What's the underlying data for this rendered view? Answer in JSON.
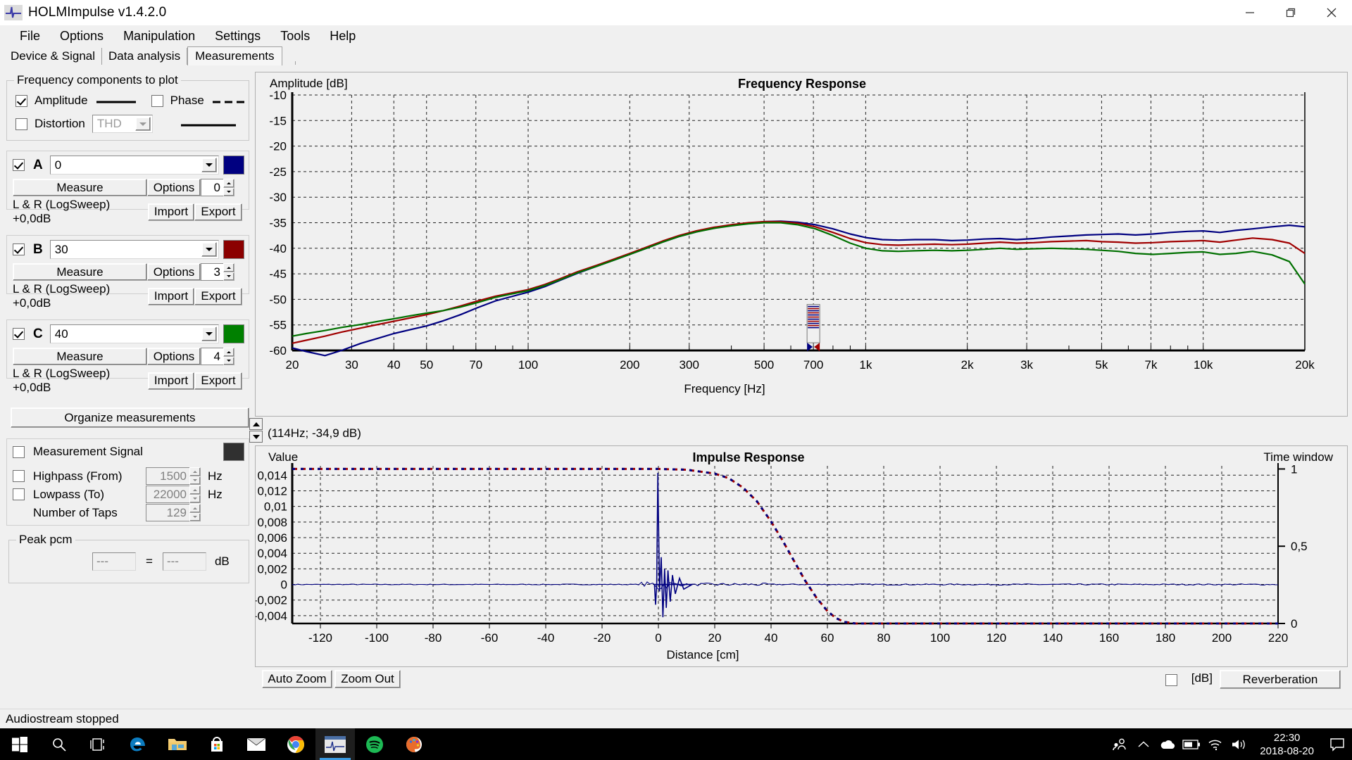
{
  "window": {
    "title": "HOLMImpulse  v1.4.2.0",
    "icon": "holmimpulse-logo-icon",
    "minimize": "minimize-icon",
    "maximize": "restore-icon",
    "close": "close-icon"
  },
  "menu": [
    "File",
    "Options",
    "Manipulation",
    "Settings",
    "Tools",
    "Help"
  ],
  "tabs": [
    {
      "label": "Device & Signal",
      "active": false
    },
    {
      "label": "Data analysis",
      "active": false
    },
    {
      "label": "Measurements",
      "active": true
    }
  ],
  "freq_components": {
    "title": "Frequency components to plot",
    "amplitude": {
      "label": "Amplitude",
      "checked": true,
      "line": "solid"
    },
    "phase": {
      "label": "Phase",
      "checked": false,
      "line": "dashed"
    },
    "distortion": {
      "label": "Distortion",
      "checked": false,
      "select_value": "THD",
      "line": "solid"
    }
  },
  "measurements": [
    {
      "id": "A",
      "checked": true,
      "name": "0",
      "measure": "Measure",
      "options": "Options",
      "index": "0",
      "info": "L & R (LogSweep) +0,0dB",
      "import": "Import",
      "export": "Export",
      "color": "#000080"
    },
    {
      "id": "B",
      "checked": true,
      "name": "30",
      "measure": "Measure",
      "options": "Options",
      "index": "3",
      "info": "L & R (LogSweep) +0,0dB",
      "import": "Import",
      "export": "Export",
      "color": "#8b0000"
    },
    {
      "id": "C",
      "checked": true,
      "name": "40",
      "measure": "Measure",
      "options": "Options",
      "index": "4",
      "info": "L & R (LogSweep) +0,0dB",
      "import": "Import",
      "export": "Export",
      "color": "#008000"
    }
  ],
  "organize_button": "Organize measurements",
  "measurement_signal": {
    "label": "Measurement Signal",
    "checked": false,
    "color": "#303030"
  },
  "filters": {
    "highpass": {
      "label": "Highpass (From)",
      "checked": false,
      "value": "1500",
      "unit": "Hz"
    },
    "lowpass": {
      "label": "Lowpass (To)",
      "checked": false,
      "value": "22000",
      "unit": "Hz"
    },
    "taps": {
      "label": "Number of Taps",
      "value": "129"
    }
  },
  "peak_pcm": {
    "title": "Peak pcm",
    "value1": "---",
    "equals": "=",
    "value2": "---",
    "unit": "dB"
  },
  "cursor_readout": "(114Hz; -34,9 dB)",
  "impulse_buttons": {
    "auto_zoom": "Auto Zoom",
    "zoom_out": "Zoom Out"
  },
  "impulse_footer": {
    "db_label": "[dB]",
    "db_checked": false,
    "reverberation": "Reverberation"
  },
  "statusbar": "Audiostream stopped",
  "taskbar": {
    "items": [
      "start-icon",
      "search-icon",
      "task-view-icon",
      "edge-icon",
      "file-explorer-icon",
      "microsoft-store-icon",
      "mail-icon",
      "chrome-icon",
      "holmimpulse-icon",
      "spotify-icon",
      "paint-3d-icon"
    ],
    "tray": [
      "people-icon",
      "show-hidden-icons-icon",
      "onedrive-icon",
      "battery-icon",
      "wifi-icon",
      "volume-icon"
    ],
    "time": "22:30",
    "date": "2018-08-20",
    "action_center": "action-center-icon"
  },
  "chart_data": [
    {
      "type": "line",
      "name": "frequency-response",
      "title": "Frequency Response",
      "xlabel": "Frequency [Hz]",
      "ylabel": "Amplitude [dB]",
      "xscale": "log",
      "xlim": [
        20,
        20000
      ],
      "ylim": [
        -60,
        -10
      ],
      "yticks": [
        -10,
        -15,
        -20,
        -25,
        -30,
        -35,
        -40,
        -45,
        -50,
        -55,
        -60
      ],
      "xticks": [
        20,
        30,
        40,
        50,
        70,
        100,
        200,
        300,
        500,
        700,
        1000,
        2000,
        3000,
        5000,
        7000,
        10000,
        20000
      ],
      "xticklabels": [
        "20",
        "30",
        "40",
        "50",
        "70",
        "100",
        "200",
        "300",
        "500",
        "700",
        "1k",
        "2k",
        "3k",
        "5k",
        "7k",
        "10k",
        "20k"
      ],
      "grid": true,
      "series": [
        {
          "name": "A",
          "color": "#000080",
          "x": [
            20,
            22,
            25,
            28,
            32,
            36,
            40,
            45,
            50,
            56,
            63,
            71,
            80,
            90,
            100,
            112,
            125,
            140,
            160,
            180,
            200,
            224,
            250,
            280,
            315,
            355,
            400,
            450,
            500,
            560,
            630,
            710,
            800,
            900,
            1000,
            1120,
            1250,
            1400,
            1600,
            1800,
            2000,
            2240,
            2500,
            2800,
            3150,
            3550,
            4000,
            4500,
            5000,
            5600,
            6300,
            7100,
            8000,
            9000,
            10000,
            11200,
            12500,
            14000,
            16000,
            18000,
            20000
          ],
          "y": [
            -59.5,
            -60.2,
            -61.0,
            -60.0,
            -58.6,
            -57.6,
            -56.7,
            -55.9,
            -55.2,
            -54.2,
            -53.0,
            -51.6,
            -50.3,
            -49.4,
            -48.6,
            -47.5,
            -46.2,
            -44.9,
            -43.5,
            -42.3,
            -41.2,
            -40.0,
            -38.8,
            -37.7,
            -36.8,
            -36.0,
            -35.5,
            -35.1,
            -34.8,
            -34.7,
            -34.9,
            -35.4,
            -36.2,
            -37.2,
            -37.9,
            -38.3,
            -38.4,
            -38.3,
            -38.3,
            -38.5,
            -38.4,
            -38.2,
            -38.1,
            -38.3,
            -38.1,
            -37.8,
            -37.6,
            -37.4,
            -37.3,
            -37.2,
            -37.4,
            -37.2,
            -36.9,
            -36.7,
            -36.6,
            -36.9,
            -36.5,
            -36.2,
            -35.8,
            -35.5,
            -35.8
          ]
        },
        {
          "name": "B",
          "color": "#a00000",
          "x": [
            20,
            22,
            25,
            28,
            32,
            36,
            40,
            45,
            50,
            56,
            63,
            71,
            80,
            90,
            100,
            112,
            125,
            140,
            160,
            180,
            200,
            224,
            250,
            280,
            315,
            355,
            400,
            450,
            500,
            560,
            630,
            710,
            800,
            900,
            1000,
            1120,
            1250,
            1400,
            1600,
            1800,
            2000,
            2240,
            2500,
            2800,
            3150,
            3550,
            4000,
            4500,
            5000,
            5600,
            6300,
            7100,
            8000,
            9000,
            10000,
            11200,
            12500,
            14000,
            16000,
            18000,
            20000
          ],
          "y": [
            -58.6,
            -58.0,
            -57.2,
            -56.4,
            -55.6,
            -54.9,
            -54.3,
            -53.6,
            -53.0,
            -52.2,
            -51.3,
            -50.3,
            -49.4,
            -48.7,
            -48.1,
            -47.1,
            -45.9,
            -44.6,
            -43.3,
            -42.1,
            -41.0,
            -39.8,
            -38.6,
            -37.5,
            -36.6,
            -35.9,
            -35.4,
            -35.0,
            -34.8,
            -34.8,
            -35.1,
            -35.8,
            -36.9,
            -38.1,
            -38.9,
            -39.3,
            -39.4,
            -39.3,
            -39.2,
            -39.3,
            -39.2,
            -39.0,
            -38.8,
            -39.0,
            -38.9,
            -38.7,
            -38.6,
            -38.5,
            -38.7,
            -38.8,
            -39.0,
            -38.9,
            -38.7,
            -38.6,
            -38.5,
            -38.8,
            -38.4,
            -38.0,
            -38.3,
            -39.0,
            -41.0
          ]
        },
        {
          "name": "C",
          "color": "#007000",
          "x": [
            20,
            22,
            25,
            28,
            32,
            36,
            40,
            45,
            50,
            56,
            63,
            71,
            80,
            90,
            100,
            112,
            125,
            140,
            160,
            180,
            200,
            224,
            250,
            280,
            315,
            355,
            400,
            450,
            500,
            560,
            630,
            710,
            800,
            900,
            1000,
            1120,
            1250,
            1400,
            1600,
            1800,
            2000,
            2240,
            2500,
            2800,
            3150,
            3550,
            4000,
            4500,
            5000,
            5600,
            6300,
            7100,
            8000,
            9000,
            10000,
            11200,
            12500,
            14000,
            16000,
            18000,
            20000
          ],
          "y": [
            -57.2,
            -56.7,
            -56.1,
            -55.5,
            -54.9,
            -54.3,
            -53.8,
            -53.2,
            -52.7,
            -52.2,
            -51.5,
            -50.6,
            -49.6,
            -48.9,
            -48.3,
            -47.3,
            -46.1,
            -44.8,
            -43.5,
            -42.3,
            -41.2,
            -40.0,
            -38.8,
            -37.7,
            -36.8,
            -36.1,
            -35.6,
            -35.2,
            -35.0,
            -35.0,
            -35.4,
            -36.2,
            -37.5,
            -39.0,
            -40.0,
            -40.5,
            -40.6,
            -40.5,
            -40.4,
            -40.5,
            -40.4,
            -40.2,
            -40.0,
            -40.2,
            -40.1,
            -40.0,
            -40.1,
            -40.2,
            -40.4,
            -40.6,
            -41.0,
            -41.2,
            -41.0,
            -40.8,
            -40.7,
            -41.2,
            -41.0,
            -40.6,
            -41.3,
            -42.6,
            -47.0
          ]
        }
      ],
      "cursor_marker": {
        "x": 700,
        "label": "marker"
      }
    },
    {
      "type": "line",
      "name": "impulse-response",
      "title": "Impulse Response",
      "xlabel": "Distance [cm]",
      "ylabel": "Value",
      "ylabel_right": "Time window",
      "xlim": [
        -130,
        220
      ],
      "ylim": [
        -0.005,
        0.0152
      ],
      "yticks": [
        0.014,
        0.012,
        0.01,
        0.008,
        0.006,
        0.004,
        0.002,
        0,
        -0.002,
        -0.004
      ],
      "yticklabels": [
        "0,014",
        "0,012",
        "0,01",
        "0,008",
        "0,006",
        "0,004",
        "0,002",
        "0",
        "-0,002",
        "-0,004"
      ],
      "xticks": [
        -120,
        -100,
        -80,
        -60,
        -40,
        -20,
        0,
        20,
        40,
        60,
        80,
        100,
        120,
        140,
        160,
        180,
        200,
        220
      ],
      "right_yticks": [
        1,
        0.5,
        0
      ],
      "right_yticklabels": [
        "1",
        "0,5",
        "0"
      ],
      "grid": true,
      "window_curve": {
        "name": "time-window",
        "colors": [
          "#000080",
          "#a00000"
        ],
        "x": [
          -130,
          -60,
          0,
          10,
          20,
          25,
          30,
          35,
          40,
          44,
          48,
          52,
          56,
          60,
          63,
          66,
          70,
          100,
          220
        ],
        "y": [
          1,
          1,
          1,
          0.995,
          0.97,
          0.94,
          0.88,
          0.79,
          0.66,
          0.54,
          0.41,
          0.28,
          0.17,
          0.08,
          0.035,
          0.01,
          0,
          0,
          0
        ]
      },
      "impulse_peak": {
        "x": 0,
        "y": 0.0143
      }
    }
  ]
}
